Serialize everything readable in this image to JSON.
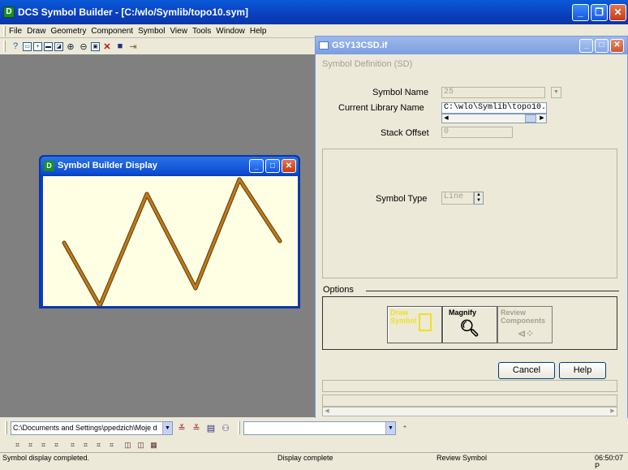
{
  "app": {
    "title": "DCS Symbol Builder - [C:/wlo/Symlib/topo10.sym]"
  },
  "menu": [
    "File",
    "Draw",
    "Geometry",
    "Component",
    "Symbol",
    "View",
    "Tools",
    "Window",
    "Help"
  ],
  "display_window": {
    "title": "Symbol Builder Display",
    "polyline_color": "#c07a1a"
  },
  "dialog": {
    "title": "GSY13CSD.if",
    "section_title": "Symbol Definition (SD)",
    "symbol_name_label": "Symbol Name",
    "symbol_name_value": "25",
    "library_label": "Current Library Name",
    "library_value": "C:\\wlo\\Symlib\\topo10.",
    "stack_offset_label": "Stack Offset",
    "stack_offset_value": "0",
    "symbol_type_label": "Symbol Type",
    "symbol_type_value": "Line",
    "options_label": "Options",
    "btn_draw": "Draw\nSymbol",
    "btn_magnify": "Magnify",
    "btn_review": "Review\nComponents",
    "cancel": "Cancel",
    "help": "Help"
  },
  "bottom": {
    "path_value": "C:\\Documents and Settings\\ppedzich\\Moje d",
    "second_combo": ""
  },
  "status": {
    "left": "Symbol display completed.",
    "middle": "Display complete",
    "right": "Review Symbol",
    "time": "06:50:07 P"
  }
}
